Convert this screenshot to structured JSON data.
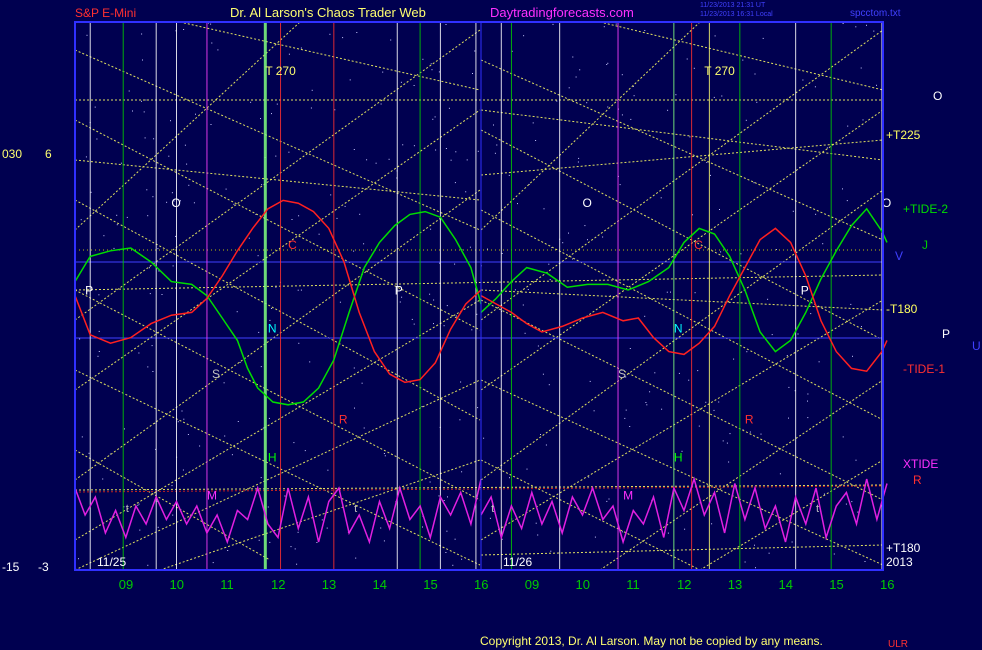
{
  "header": {
    "symbol": "S&P E-Mini",
    "title": "Dr. Al Larson's Chaos Trader Web",
    "site": "Daytradingforecasts.com",
    "timestamp_line1": "11/23/2013 21:31 UT",
    "timestamp_line2": "11/23/2013 16:31 Local",
    "file": "spcctom.txt"
  },
  "footer": {
    "copyright": "Copyright 2013, Dr. Al Larson. May not be copied by any means.",
    "corner": "ULR"
  },
  "left_axis": {
    "row1_left": "030",
    "row1_right": "6",
    "row2_left": "-15",
    "row2_right": "-3"
  },
  "colors": {
    "background": "#000050",
    "frame": "#3030ff",
    "tide2": "#00cc00",
    "tide1": "#ff2020",
    "xtide": "#e020e0",
    "fib_lines": "#e0e060",
    "dates": "#e0e0e0",
    "hours": "#00cc00"
  },
  "chart_data": {
    "type": "line",
    "days": [
      "11/25",
      "11/26"
    ],
    "year_label": "2013",
    "x_hour_ticks": [
      "09",
      "10",
      "11",
      "12",
      "13",
      "14",
      "15",
      "16",
      "09",
      "10",
      "11",
      "12",
      "13",
      "14",
      "15",
      "16"
    ],
    "right_labels": [
      {
        "text": "O",
        "color": "#ffffff"
      },
      {
        "text": "+T225",
        "color": "#ffff60"
      },
      {
        "text": "+TIDE-2",
        "color": "#00dd00"
      },
      {
        "text": "J",
        "color": "#00cc00"
      },
      {
        "text": "V",
        "color": "#4040ff"
      },
      {
        "text": "-T180",
        "color": "#ffff60"
      },
      {
        "text": "P",
        "color": "#ffffff"
      },
      {
        "text": "U",
        "color": "#4040ff"
      },
      {
        "text": "-TIDE-1",
        "color": "#ff3030"
      },
      {
        "text": "XTIDE",
        "color": "#ff30ff"
      },
      {
        "text": "R",
        "color": "#ff3030"
      },
      {
        "text": "+T180",
        "color": "#ffffff"
      }
    ],
    "vertical_markers": [
      {
        "label": "T  270",
        "day": 1,
        "hour": 11.75
      },
      {
        "label": "T  270",
        "day": 2,
        "hour": 12.4
      }
    ],
    "planet_labels": [
      {
        "t": "O",
        "d": 1,
        "h": 9.9,
        "band": 0.15,
        "c": "#ffffff"
      },
      {
        "t": "P",
        "d": 1,
        "h": 8.2,
        "band": 0.38,
        "c": "#ffffff"
      },
      {
        "t": "S",
        "d": 1,
        "h": 10.7,
        "band": 0.6,
        "c": "#c0c0c0"
      },
      {
        "t": "N",
        "d": 1,
        "h": 11.8,
        "band": 0.48,
        "c": "#00ffff"
      },
      {
        "t": "C",
        "d": 1,
        "h": 12.2,
        "band": 0.26,
        "c": "#ff3030"
      },
      {
        "t": "H",
        "d": 1,
        "h": 11.8,
        "band": 0.82,
        "c": "#00ff00"
      },
      {
        "t": "R",
        "d": 1,
        "h": 13.2,
        "band": 0.72,
        "c": "#ff3030"
      },
      {
        "t": "P",
        "d": 1,
        "h": 14.3,
        "band": 0.38,
        "c": "#ffffff"
      },
      {
        "t": "M",
        "d": 1,
        "h": 10.6,
        "band": 0.92,
        "c": "#ff30ff"
      },
      {
        "t": "O",
        "d": 2,
        "h": 10.0,
        "band": 0.15,
        "c": "#ffffff"
      },
      {
        "t": "S",
        "d": 2,
        "h": 10.7,
        "band": 0.6,
        "c": "#c0c0c0"
      },
      {
        "t": "N",
        "d": 2,
        "h": 11.8,
        "band": 0.48,
        "c": "#00ffff"
      },
      {
        "t": "C",
        "d": 2,
        "h": 12.2,
        "band": 0.26,
        "c": "#ff3030"
      },
      {
        "t": "H",
        "d": 2,
        "h": 11.8,
        "band": 0.82,
        "c": "#00ff00"
      },
      {
        "t": "R",
        "d": 2,
        "h": 13.2,
        "band": 0.72,
        "c": "#ff3030"
      },
      {
        "t": "P",
        "d": 2,
        "h": 14.3,
        "band": 0.38,
        "c": "#ffffff"
      },
      {
        "t": "M",
        "d": 2,
        "h": 10.8,
        "band": 0.92,
        "c": "#ff30ff"
      },
      {
        "t": "O",
        "d": 2,
        "h": 15.9,
        "band": 0.15,
        "c": "#ffffff"
      }
    ],
    "series": [
      {
        "name": "+TIDE-2",
        "color": "#00dd00",
        "day1": [
          [
            8.0,
            0.47
          ],
          [
            8.3,
            0.38
          ],
          [
            8.7,
            0.36
          ],
          [
            9.1,
            0.35
          ],
          [
            9.5,
            0.4
          ],
          [
            9.9,
            0.47
          ],
          [
            10.3,
            0.48
          ],
          [
            10.6,
            0.52
          ],
          [
            10.9,
            0.6
          ],
          [
            11.2,
            0.68
          ],
          [
            11.4,
            0.78
          ],
          [
            11.6,
            0.85
          ],
          [
            11.9,
            0.9
          ],
          [
            12.2,
            0.91
          ],
          [
            12.5,
            0.9
          ],
          [
            12.8,
            0.85
          ],
          [
            13.1,
            0.75
          ],
          [
            13.4,
            0.58
          ],
          [
            13.7,
            0.42
          ],
          [
            14.0,
            0.33
          ],
          [
            14.3,
            0.27
          ],
          [
            14.6,
            0.23
          ],
          [
            14.9,
            0.22
          ],
          [
            15.2,
            0.24
          ],
          [
            15.5,
            0.32
          ],
          [
            15.8,
            0.42
          ],
          [
            16.0,
            0.55
          ]
        ],
        "day2": [
          [
            8.0,
            0.58
          ],
          [
            8.3,
            0.53
          ],
          [
            8.6,
            0.47
          ],
          [
            8.9,
            0.42
          ],
          [
            9.3,
            0.44
          ],
          [
            9.7,
            0.49
          ],
          [
            10.1,
            0.48
          ],
          [
            10.5,
            0.48
          ],
          [
            10.9,
            0.5
          ],
          [
            11.3,
            0.47
          ],
          [
            11.7,
            0.42
          ],
          [
            12.0,
            0.33
          ],
          [
            12.3,
            0.28
          ],
          [
            12.6,
            0.3
          ],
          [
            12.9,
            0.38
          ],
          [
            13.2,
            0.5
          ],
          [
            13.5,
            0.65
          ],
          [
            13.8,
            0.72
          ],
          [
            14.1,
            0.68
          ],
          [
            14.4,
            0.58
          ],
          [
            14.7,
            0.46
          ],
          [
            15.0,
            0.36
          ],
          [
            15.3,
            0.27
          ],
          [
            15.6,
            0.21
          ],
          [
            15.9,
            0.29
          ],
          [
            16.0,
            0.33
          ]
        ]
      },
      {
        "name": "-TIDE-1",
        "color": "#ff2020",
        "day1": [
          [
            8.0,
            0.52
          ],
          [
            8.3,
            0.66
          ],
          [
            8.7,
            0.69
          ],
          [
            9.1,
            0.67
          ],
          [
            9.5,
            0.62
          ],
          [
            9.9,
            0.59
          ],
          [
            10.3,
            0.58
          ],
          [
            10.6,
            0.53
          ],
          [
            10.9,
            0.45
          ],
          [
            11.2,
            0.36
          ],
          [
            11.5,
            0.28
          ],
          [
            11.8,
            0.21
          ],
          [
            12.1,
            0.18
          ],
          [
            12.4,
            0.19
          ],
          [
            12.7,
            0.22
          ],
          [
            13.0,
            0.28
          ],
          [
            13.3,
            0.4
          ],
          [
            13.6,
            0.58
          ],
          [
            13.9,
            0.72
          ],
          [
            14.2,
            0.8
          ],
          [
            14.5,
            0.83
          ],
          [
            14.8,
            0.82
          ],
          [
            15.1,
            0.76
          ],
          [
            15.4,
            0.64
          ],
          [
            15.7,
            0.55
          ],
          [
            16.0,
            0.5
          ]
        ],
        "day2": [
          [
            8.0,
            0.52
          ],
          [
            8.3,
            0.55
          ],
          [
            8.6,
            0.58
          ],
          [
            8.9,
            0.62
          ],
          [
            9.2,
            0.65
          ],
          [
            9.6,
            0.63
          ],
          [
            10.0,
            0.6
          ],
          [
            10.4,
            0.58
          ],
          [
            10.8,
            0.61
          ],
          [
            11.1,
            0.6
          ],
          [
            11.4,
            0.67
          ],
          [
            11.7,
            0.72
          ],
          [
            12.0,
            0.73
          ],
          [
            12.3,
            0.69
          ],
          [
            12.6,
            0.63
          ],
          [
            12.9,
            0.52
          ],
          [
            13.2,
            0.42
          ],
          [
            13.5,
            0.32
          ],
          [
            13.8,
            0.28
          ],
          [
            14.1,
            0.33
          ],
          [
            14.4,
            0.45
          ],
          [
            14.7,
            0.61
          ],
          [
            15.0,
            0.72
          ],
          [
            15.3,
            0.78
          ],
          [
            15.6,
            0.79
          ],
          [
            15.9,
            0.72
          ],
          [
            16.0,
            0.68
          ]
        ]
      },
      {
        "name": "XTIDE",
        "color": "#e020e0",
        "day1": [
          [
            8.0,
            0.2
          ],
          [
            8.2,
            0.5
          ],
          [
            8.4,
            0.3
          ],
          [
            8.6,
            0.7
          ],
          [
            8.8,
            0.45
          ],
          [
            9.0,
            0.75
          ],
          [
            9.2,
            0.4
          ],
          [
            9.4,
            0.6
          ],
          [
            9.6,
            0.3
          ],
          [
            9.8,
            0.55
          ],
          [
            10.0,
            0.35
          ],
          [
            10.2,
            0.6
          ],
          [
            10.4,
            0.4
          ],
          [
            10.6,
            0.7
          ],
          [
            10.8,
            0.5
          ],
          [
            11.0,
            0.8
          ],
          [
            11.2,
            0.45
          ],
          [
            11.4,
            0.55
          ],
          [
            11.6,
            0.2
          ],
          [
            11.8,
            0.6
          ],
          [
            12.0,
            0.75
          ],
          [
            12.2,
            0.2
          ],
          [
            12.4,
            0.65
          ],
          [
            12.6,
            0.3
          ],
          [
            12.8,
            0.8
          ],
          [
            13.0,
            0.35
          ],
          [
            13.2,
            0.2
          ],
          [
            13.4,
            0.7
          ],
          [
            13.6,
            0.5
          ],
          [
            13.8,
            0.8
          ],
          [
            14.0,
            0.35
          ],
          [
            14.2,
            0.65
          ],
          [
            14.4,
            0.2
          ],
          [
            14.6,
            0.55
          ],
          [
            14.8,
            0.4
          ],
          [
            15.0,
            0.75
          ],
          [
            15.2,
            0.3
          ],
          [
            15.4,
            0.5
          ],
          [
            15.6,
            0.25
          ],
          [
            15.8,
            0.6
          ],
          [
            16.0,
            0.1
          ]
        ],
        "day2": [
          [
            8.0,
            0.5
          ],
          [
            8.2,
            0.3
          ],
          [
            8.4,
            0.75
          ],
          [
            8.6,
            0.4
          ],
          [
            8.8,
            0.65
          ],
          [
            9.0,
            0.25
          ],
          [
            9.2,
            0.6
          ],
          [
            9.4,
            0.35
          ],
          [
            9.6,
            0.7
          ],
          [
            9.8,
            0.3
          ],
          [
            10.0,
            0.5
          ],
          [
            10.2,
            0.2
          ],
          [
            10.4,
            0.55
          ],
          [
            10.6,
            0.4
          ],
          [
            10.8,
            0.8
          ],
          [
            11.0,
            0.45
          ],
          [
            11.2,
            0.6
          ],
          [
            11.4,
            0.3
          ],
          [
            11.6,
            0.75
          ],
          [
            11.8,
            0.2
          ],
          [
            12.0,
            0.45
          ],
          [
            12.2,
            0.1
          ],
          [
            12.4,
            0.5
          ],
          [
            12.6,
            0.25
          ],
          [
            12.8,
            0.7
          ],
          [
            13.0,
            0.15
          ],
          [
            13.2,
            0.55
          ],
          [
            13.4,
            0.2
          ],
          [
            13.6,
            0.65
          ],
          [
            13.8,
            0.4
          ],
          [
            14.0,
            0.8
          ],
          [
            14.2,
            0.3
          ],
          [
            14.4,
            0.6
          ],
          [
            14.6,
            0.2
          ],
          [
            14.8,
            0.75
          ],
          [
            15.0,
            0.4
          ],
          [
            15.2,
            0.25
          ],
          [
            15.4,
            0.6
          ],
          [
            15.6,
            0.1
          ],
          [
            15.8,
            0.55
          ],
          [
            16.0,
            0.15
          ]
        ]
      }
    ]
  }
}
